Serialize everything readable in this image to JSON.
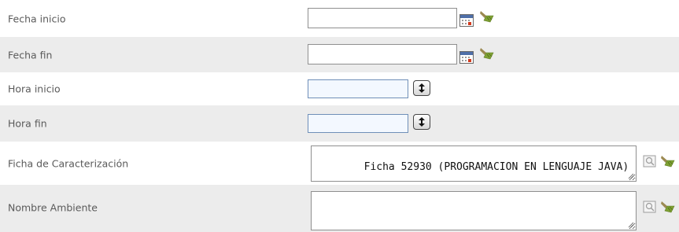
{
  "fields": {
    "fecha_inicio": {
      "label": "Fecha inicio",
      "value": ""
    },
    "fecha_fin": {
      "label": "Fecha fin",
      "value": ""
    },
    "hora_inicio": {
      "label": "Hora inicio",
      "value": ""
    },
    "hora_fin": {
      "label": "Hora fin",
      "value": ""
    },
    "ficha": {
      "label": "Ficha de Caracterización",
      "value": "Ficha 52930 (PROGRAMACION EN LENGUAJE JAVA)"
    },
    "ambiente": {
      "label": "Nombre Ambiente",
      "value": ""
    }
  },
  "icons": {
    "calendar": "calendar-icon",
    "clear": "broom-clear-icon",
    "search": "magnifier-search-icon",
    "spinner": "up-down-spinner-icon"
  },
  "colors": {
    "row_alt": "#ececec",
    "time_input_bg": "#f3f8ff",
    "time_input_border": "#6f8fb8",
    "calendar_red": "#d23a1e"
  }
}
